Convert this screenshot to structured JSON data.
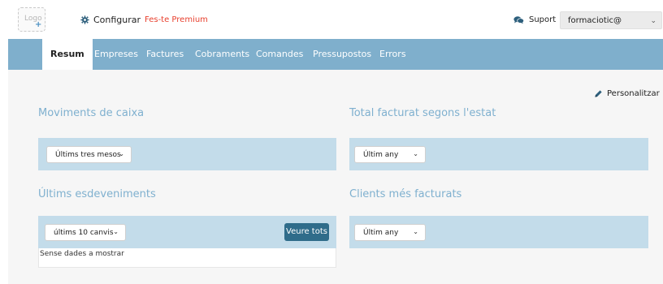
{
  "topbar": {
    "logo_text": "Logo",
    "logo_plus": "+",
    "configure_label": "Configurar",
    "premium_label": "Fes-te Premium",
    "support_label": "Suport",
    "user_value": "formaciotic@",
    "user_chevron": "⌄"
  },
  "nav": {
    "tabs": [
      {
        "label": "Resum",
        "active": true
      },
      {
        "label": "Empreses"
      },
      {
        "label": "Factures"
      },
      {
        "label": "Cobraments"
      },
      {
        "label": "Comandes"
      },
      {
        "label": "Pressupostos"
      },
      {
        "label": "Errors"
      }
    ]
  },
  "content": {
    "personalize_label": "Personalitzar",
    "cash_movements": {
      "title": "Moviments de caixa",
      "filter_value": "Últims tres mesos"
    },
    "total_billed": {
      "title": "Total facturat segons l'estat",
      "filter_value": "Últim any"
    },
    "latest_events": {
      "title": "Últims esdeveniments",
      "filter_value": "últims 10 canvis",
      "view_all_label": "Veure tots",
      "empty_text": "Sense dades a mostrar"
    },
    "top_clients": {
      "title": "Clients més facturats",
      "filter_value": "Últim any"
    },
    "dropdown_chevron": "⌄"
  },
  "colors": {
    "nav_bg": "#7fafcc",
    "panel_bg": "#c3dcea",
    "section_title": "#7fb0cf",
    "premium": "#e8412f",
    "button_bg": "#2f6c8a"
  },
  "icons": {
    "configure": "gear-icon",
    "support": "chat-bubbles-icon",
    "personalize": "pencil-icon",
    "user_select": "chevron-down-icon"
  }
}
